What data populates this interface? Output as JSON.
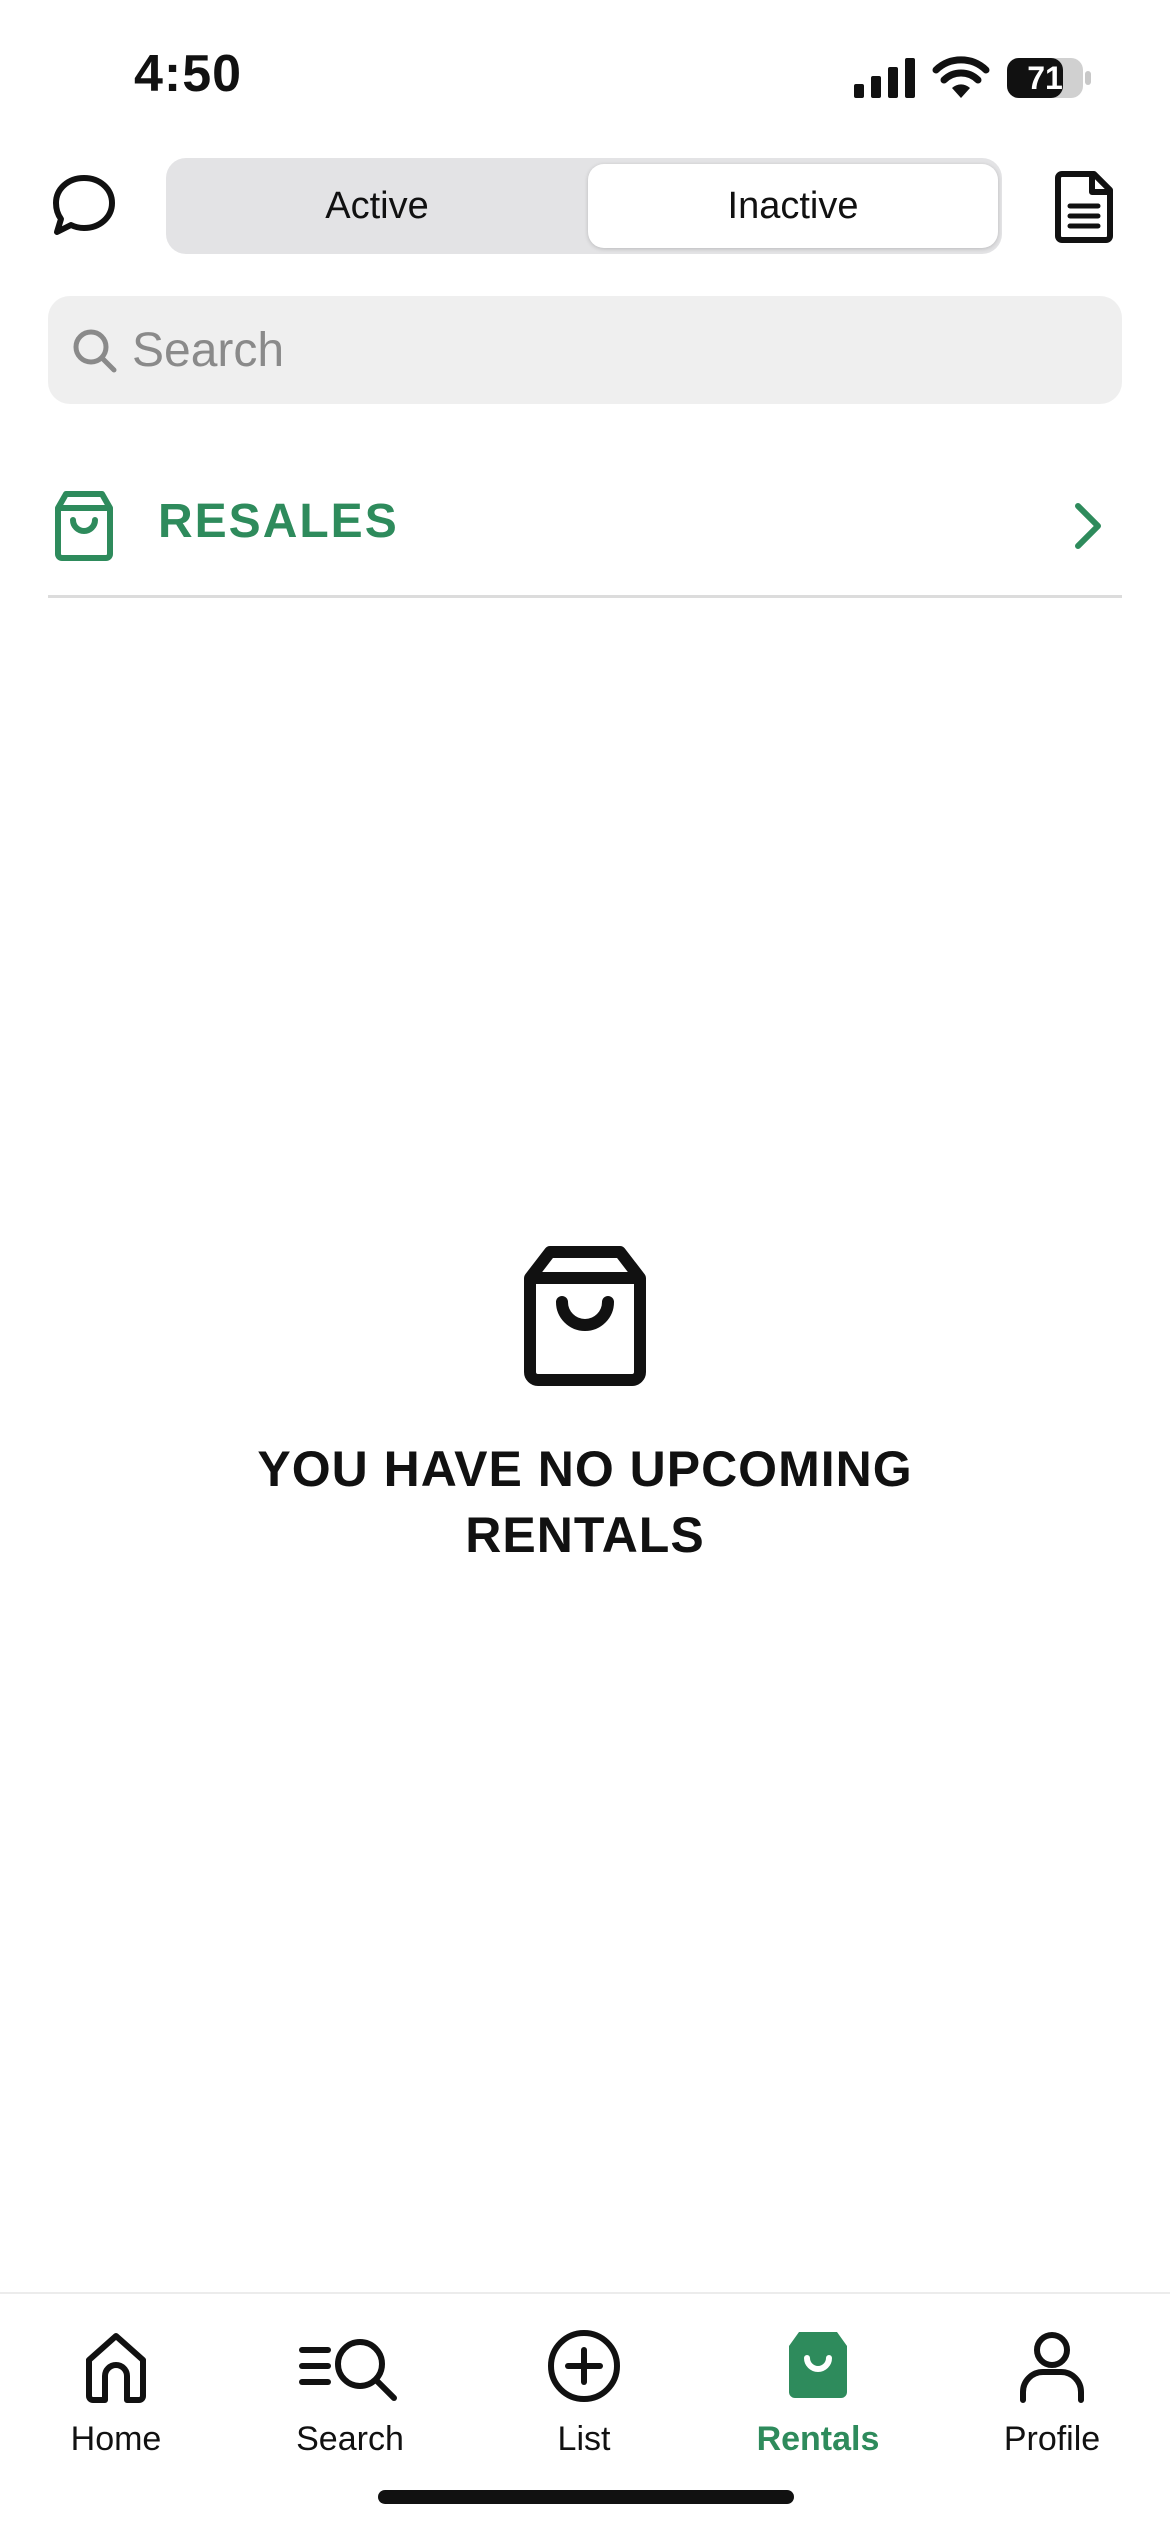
{
  "status_bar": {
    "time": "4:50",
    "battery_level": "71",
    "icons": [
      "signal-icon",
      "wifi-icon",
      "battery-icon"
    ]
  },
  "header": {
    "chat_icon": "chat-bubble-icon",
    "segments": [
      {
        "label": "Active",
        "selected": false
      },
      {
        "label": "Inactive",
        "selected": true
      }
    ],
    "document_icon": "document-icon"
  },
  "search": {
    "placeholder": "Search",
    "value": "",
    "icon": "search-icon"
  },
  "resales": {
    "label": "RESALES",
    "icon": "shopping-bag-icon",
    "chevron": "chevron-right-icon"
  },
  "empty_state": {
    "icon": "shopping-bag-icon",
    "line1": "YOU HAVE NO UPCOMING",
    "line2": "RENTALS"
  },
  "tabbar": {
    "tabs": [
      {
        "label": "Home",
        "icon": "home-icon",
        "active": false
      },
      {
        "label": "Search",
        "icon": "search-list-icon",
        "active": false
      },
      {
        "label": "List",
        "icon": "plus-circle-icon",
        "active": false
      },
      {
        "label": "Rentals",
        "icon": "shopping-bag-icon",
        "active": true
      },
      {
        "label": "Profile",
        "icon": "person-icon",
        "active": false
      }
    ]
  },
  "colors": {
    "accent": "#2e8b5c",
    "text": "#111111",
    "search_bg": "#efefef",
    "segment_bg": "#e3e3e5"
  }
}
